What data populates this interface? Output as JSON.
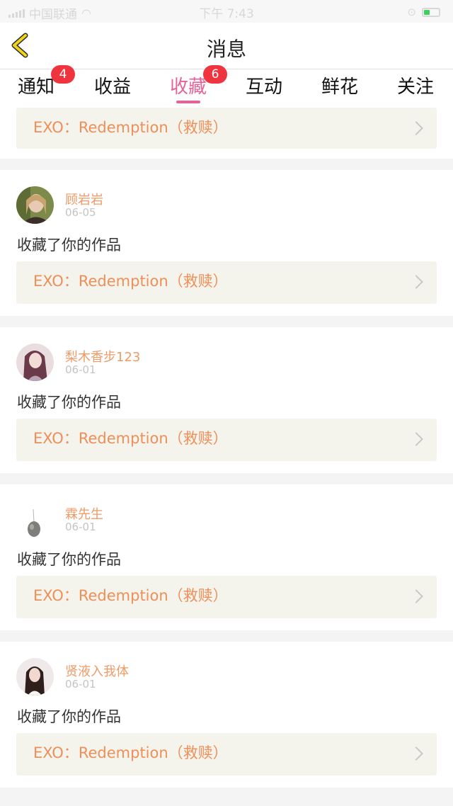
{
  "status_bar": {
    "carrier": "中国联通",
    "time": "下午 7:43"
  },
  "nav": {
    "title": "消息"
  },
  "tabs": [
    {
      "label": "通知",
      "badge": "4"
    },
    {
      "label": "收益"
    },
    {
      "label": "收藏",
      "badge": "6",
      "active": true
    },
    {
      "label": "互动"
    },
    {
      "label": "鲜花"
    },
    {
      "label": "关注"
    }
  ],
  "top_partial_item": {
    "work_title": "EXO：Redemption（救赎）"
  },
  "items": [
    {
      "user": "顾岩岩",
      "date": "06-05",
      "action": "收藏了你的作品",
      "work_title": "EXO：Redemption（救赎）"
    },
    {
      "user": "梨木香步123",
      "date": "06-01",
      "action": "收藏了你的作品",
      "work_title": "EXO：Redemption（救赎）"
    },
    {
      "user": "霖先生",
      "date": "06-01",
      "action": "收藏了你的作品",
      "work_title": "EXO：Redemption（救赎）"
    },
    {
      "user": "贤液入我体",
      "date": "06-01",
      "action": "收藏了你的作品",
      "work_title": "EXO：Redemption（救赎）"
    }
  ],
  "colors": {
    "accent": "#e4649a",
    "badge": "#f0343f",
    "work_title": "#ee8f5a",
    "username": "#ee9a66"
  }
}
